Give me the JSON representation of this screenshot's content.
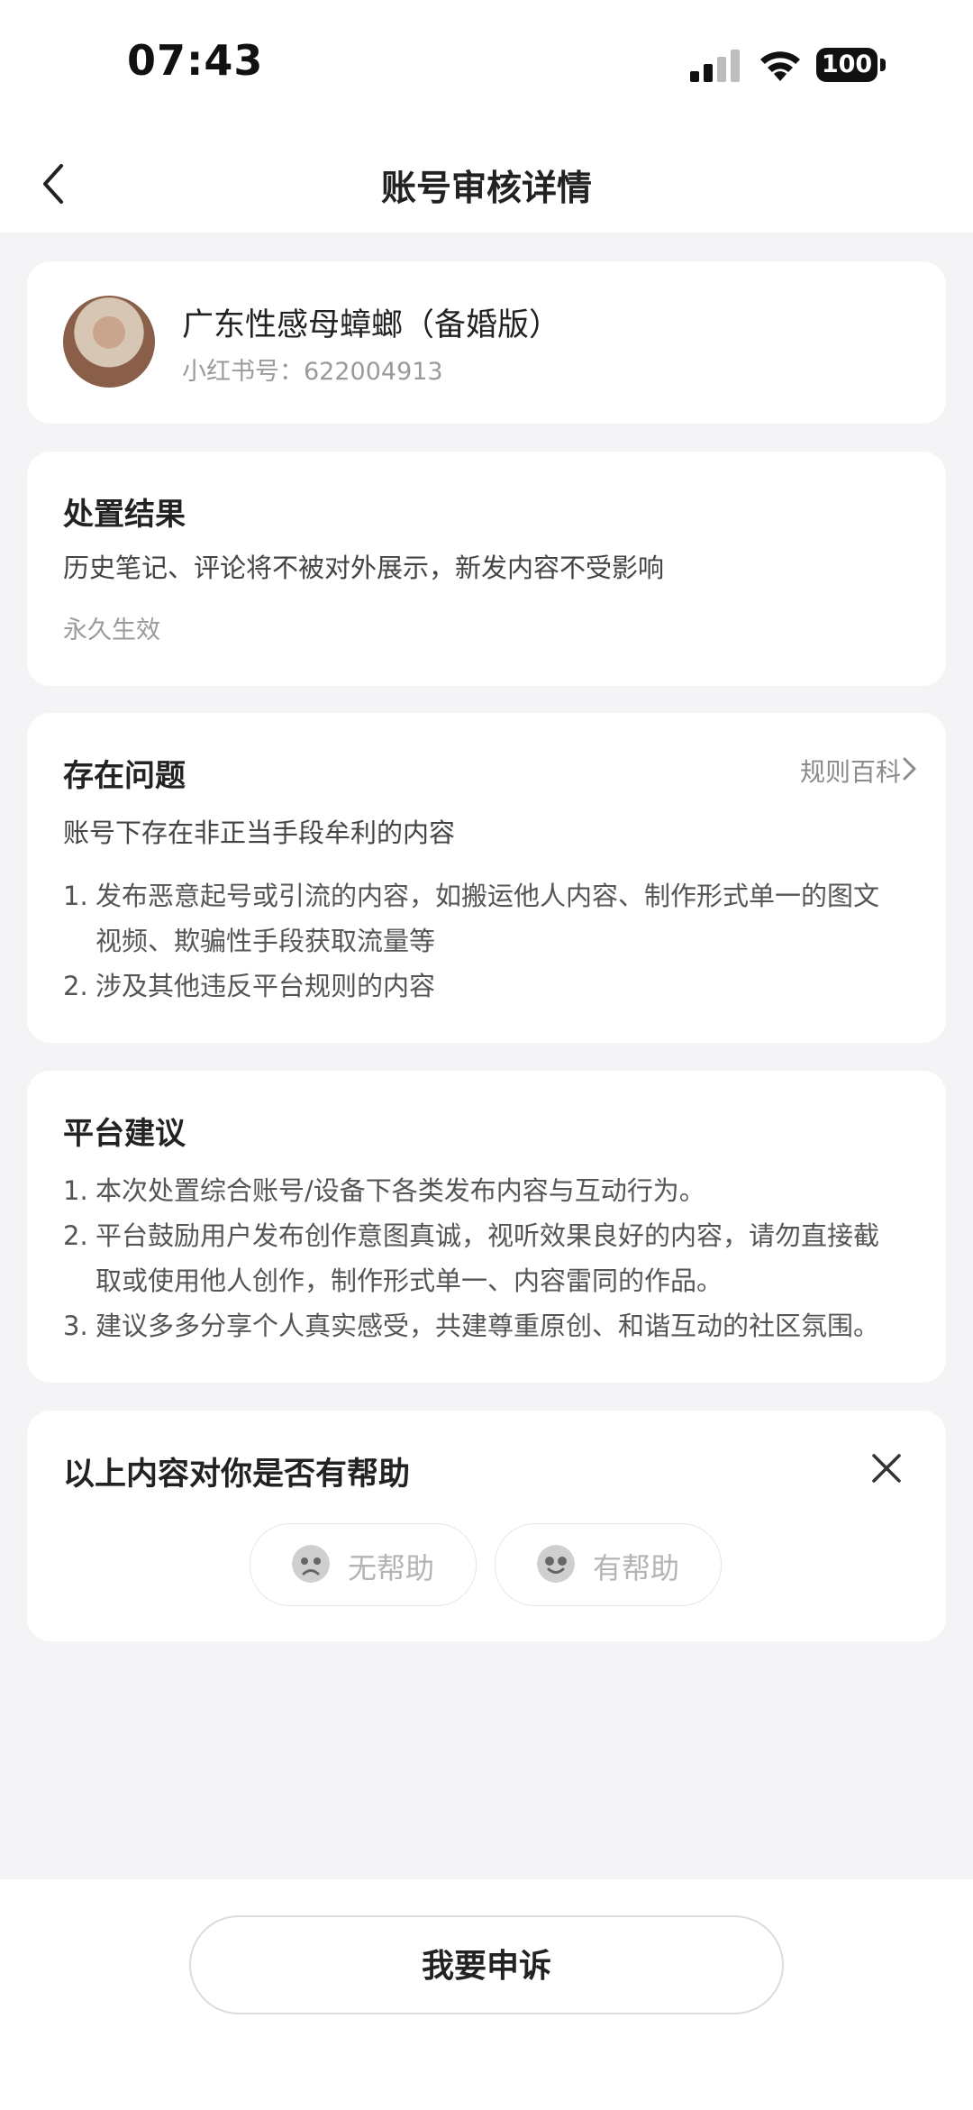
{
  "status_bar": {
    "time": "07:43",
    "battery": "100"
  },
  "nav": {
    "title": "账号审核详情"
  },
  "profile": {
    "name": "广东性感母蟑螂（备婚版）",
    "id_label": "小红书号：622004913"
  },
  "disposition": {
    "title": "处置结果",
    "description": "历史笔记、评论将不被对外展示，新发内容不受影响",
    "duration": "永久生效"
  },
  "issues": {
    "title": "存在问题",
    "rules_link": "规则百科",
    "summary": "账号下存在非正当手段牟利的内容",
    "items": [
      {
        "num": "1.",
        "lines": [
          "发布恶意起号或引流的内容，如搬运他人内容、制作形式单一的图文",
          "视频、欺骗性手段获取流量等"
        ]
      },
      {
        "num": "2.",
        "lines": [
          "涉及其他违反平台规则的内容"
        ]
      }
    ]
  },
  "advice": {
    "title": "平台建议",
    "items": [
      {
        "num": "1.",
        "lines": [
          "本次处置综合账号/设备下各类发布内容与互动行为。"
        ]
      },
      {
        "num": "2.",
        "lines": [
          "平台鼓励用户发布创作意图真诚，视听效果良好的内容，请勿直接截",
          "取或使用他人创作，制作形式单一、内容雷同的作品。"
        ]
      },
      {
        "num": "3.",
        "lines": [
          "建议多多分享个人真实感受，共建尊重原创、和谐互动的社区氛围。"
        ]
      }
    ]
  },
  "feedback": {
    "question": "以上内容对你是否有帮助",
    "not_helpful": "无帮助",
    "helpful": "有帮助"
  },
  "bottom": {
    "appeal_label": "我要申诉"
  },
  "colors": {
    "background": "#f4f4f6",
    "card": "#ffffff",
    "text": "#222222",
    "muted": "#9a9a9a"
  }
}
